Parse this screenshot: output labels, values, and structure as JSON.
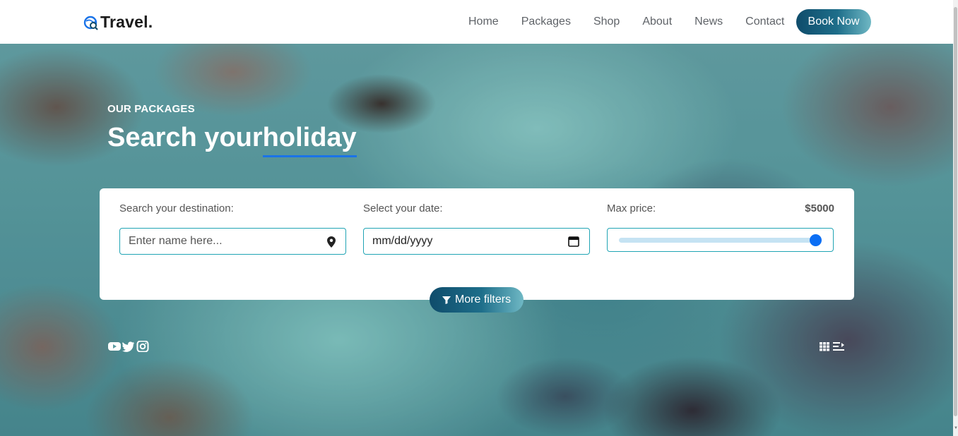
{
  "brand": {
    "name": "Travel."
  },
  "nav": {
    "items": [
      {
        "label": "Home"
      },
      {
        "label": "Packages"
      },
      {
        "label": "Shop"
      },
      {
        "label": "About"
      },
      {
        "label": "News"
      },
      {
        "label": "Contact"
      }
    ],
    "cta_label": "Book Now"
  },
  "hero": {
    "eyebrow": "OUR PACKAGES",
    "title_part1": "Search your",
    "title_highlight": "holiday"
  },
  "search": {
    "destination_label": "Search your destination:",
    "destination_placeholder": "Enter name here...",
    "destination_icon": "map-pin-icon",
    "date_label": "Select your date:",
    "date_value": "mm/dd/yyyy",
    "date_icon": "calendar-icon",
    "price_label": "Max price:",
    "price_value": "$5000",
    "price_slider_level": 1.0,
    "more_filters_label": "More filters",
    "more_filters_icon": "filter-icon"
  },
  "socials": [
    "youtube-icon",
    "twitter-icon",
    "instagram-icon"
  ],
  "view_toggles": [
    "grid-view-icon",
    "list-view-icon"
  ],
  "colors": {
    "accent_dark": "#0f4c6b",
    "accent_light": "#6fb8c4",
    "input_border": "#20a4b4",
    "highlight_underline": "#1a73e8",
    "slider_thumb": "#0b6ef4",
    "slider_track": "#c5e3f3"
  }
}
